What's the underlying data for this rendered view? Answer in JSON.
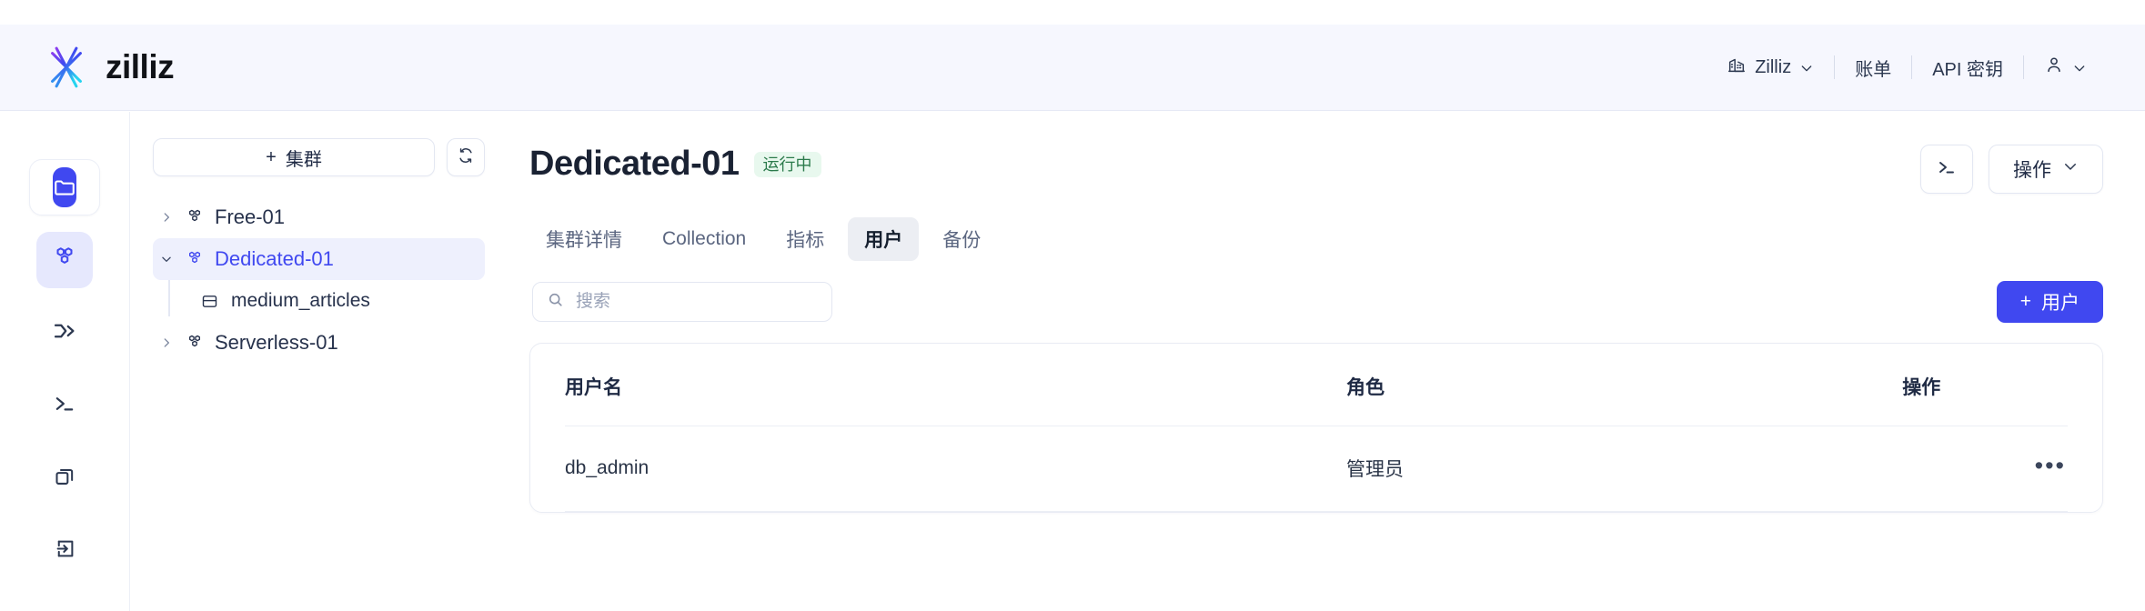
{
  "header": {
    "brand": "zilliz",
    "brand_logo_icon": "zilliz-starburst-logo",
    "org_icon": "building-icon",
    "org_label": "Zilliz",
    "billing_label": "账单",
    "api_keys_label": "API 密钥",
    "account_icon": "user-icon",
    "chevron_icon": "chevron-down-icon"
  },
  "rail": {
    "items": [
      {
        "icon": "folder-icon",
        "name": "projects"
      },
      {
        "icon": "cluster-hexagons-icon",
        "name": "clusters"
      },
      {
        "icon": "pipeline-arrow-icon",
        "name": "pipelines"
      },
      {
        "icon": "terminal-icon",
        "name": "console"
      },
      {
        "icon": "copy-stack-icon",
        "name": "backups"
      },
      {
        "icon": "import-box-icon",
        "name": "import"
      }
    ]
  },
  "tree": {
    "new_cluster_label": "集群",
    "new_cluster_plus": "+",
    "refresh_icon": "refresh-icon",
    "cluster_icon": "cluster-hexagons-icon",
    "collection_icon": "collection-icon",
    "nodes": [
      {
        "label": "Free-01",
        "expanded": false,
        "selected": false
      },
      {
        "label": "Dedicated-01",
        "expanded": true,
        "selected": true
      },
      {
        "label": "Serverless-01",
        "expanded": false,
        "selected": false
      }
    ],
    "collections": [
      {
        "label": "medium_articles"
      }
    ]
  },
  "page": {
    "title": "Dedicated-01",
    "status_badge": "运行中",
    "terminal_icon": "terminal-icon",
    "actions_label": "操作",
    "tabs": [
      {
        "label": "集群详情",
        "active": false
      },
      {
        "label": "Collection",
        "active": false
      },
      {
        "label": "指标",
        "active": false
      },
      {
        "label": "用户",
        "active": true
      },
      {
        "label": "备份",
        "active": false
      }
    ]
  },
  "toolbar": {
    "search_placeholder": "搜索",
    "search_value": "",
    "search_icon": "search-icon",
    "add_user_plus": "+",
    "add_user_label": "用户"
  },
  "table": {
    "columns": {
      "username": "用户名",
      "role": "角色",
      "operations": "操作"
    },
    "rows": [
      {
        "username": "db_admin",
        "role": "管理员",
        "menu_icon": "ellipsis-icon",
        "menu_glyph": "•••"
      }
    ]
  },
  "colors": {
    "accent": "#4048f0",
    "header_bg": "#f6f7fe",
    "selected_bg": "#eef0fd",
    "badge_bg": "#e8f8ee",
    "badge_text": "#2b7a4b",
    "active_tab_bg": "#eceef3"
  }
}
